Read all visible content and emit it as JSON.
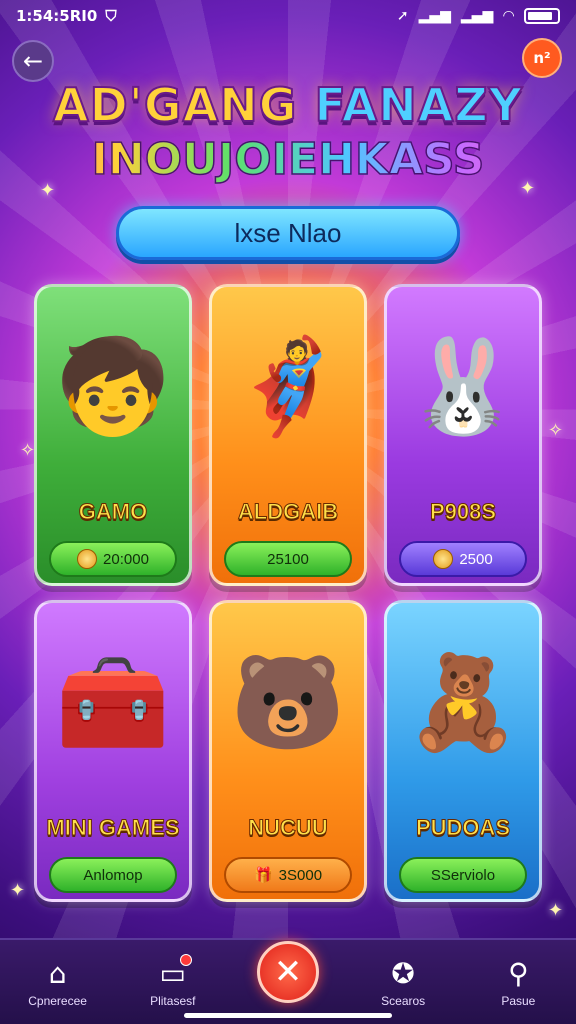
{
  "status_bar": {
    "time": "1:54:5RI0",
    "left_icon": "shield-icon",
    "right_icons": [
      "nav-arrow-icon",
      "signal-icon",
      "signal-icon",
      "wifi-icon",
      "battery-icon"
    ]
  },
  "header": {
    "back_icon": "back-arrow-icon",
    "notification_badge": "n²",
    "title_line1_a": "AD'GANG",
    "title_line1_b": "FANAZY",
    "title_line2": "INOUJOIEHKASS"
  },
  "search": {
    "label": "lxse Nlao"
  },
  "cards": [
    {
      "label": "GAMO",
      "price": "20:000",
      "art": "boy-reading-book",
      "icon": "coin-icon"
    },
    {
      "label": "ALDGAIB",
      "price": "25100",
      "art": "dancing-hero"
    },
    {
      "label": "P908S",
      "price": "2500",
      "art": "pink-bunny",
      "icon": "coin-icon"
    },
    {
      "label": "MINI GAMES",
      "price": "Anlomop",
      "art": "treasure-chest"
    },
    {
      "label": "NUCUU",
      "price": "3S000",
      "art": "bear-in-hoodie",
      "icon": "gift-icon"
    },
    {
      "label": "PUDOAS",
      "price": "SServiolo",
      "art": "pink-bear"
    }
  ],
  "bottom_nav": [
    {
      "label": "Cpnerecee",
      "icon": "home-icon"
    },
    {
      "label": "Plitasesf",
      "icon": "tv-icon"
    },
    {
      "label": "",
      "icon": "close-icon"
    },
    {
      "label": "Scearos",
      "icon": "compass-icon"
    },
    {
      "label": "Pasue",
      "icon": "search-icon"
    }
  ],
  "colors": {
    "title_gold": "#ffd23a",
    "search_blue": "#2aa6ff",
    "price_green": "#2fb22a",
    "close_red": "#e0201a"
  }
}
